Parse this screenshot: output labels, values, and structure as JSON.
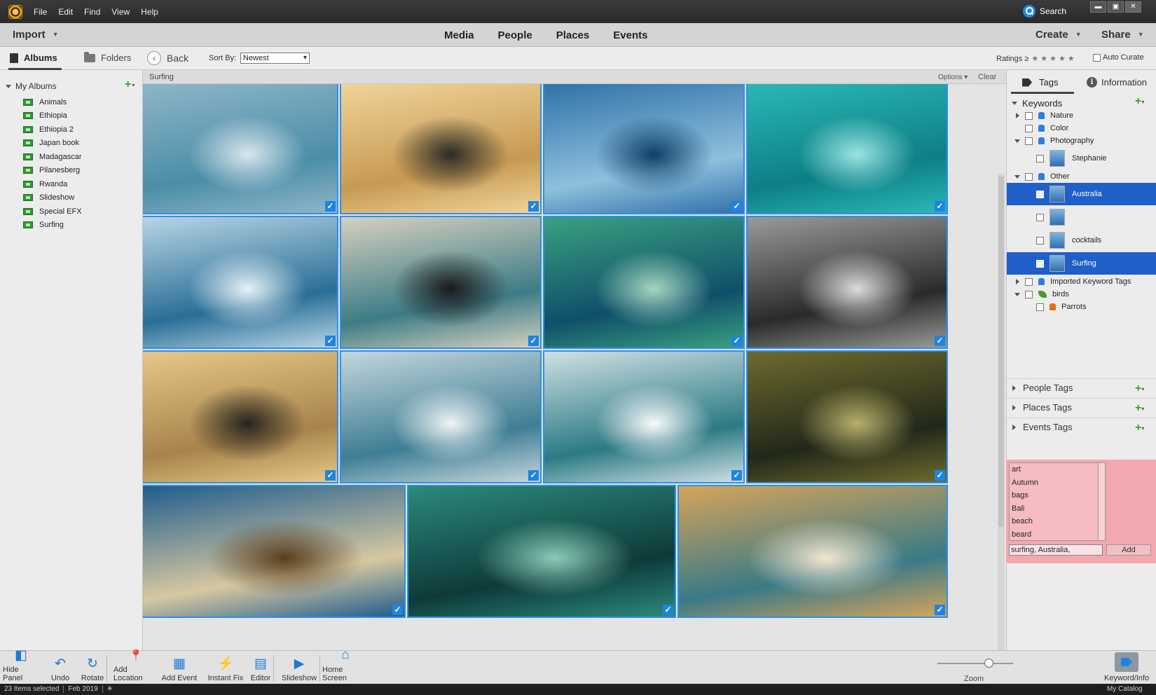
{
  "menu": [
    "File",
    "Edit",
    "Find",
    "View",
    "Help"
  ],
  "titlebar": {
    "search_label": "Search",
    "window_buttons": [
      "▬",
      "▣",
      "✕"
    ]
  },
  "modebar": {
    "import_label": "Import",
    "modes": [
      "Media",
      "People",
      "Places",
      "Events"
    ],
    "create_label": "Create",
    "share_label": "Share"
  },
  "subbar": {
    "albums_tab": "Albums",
    "folders_tab": "Folders",
    "back_label": "Back",
    "sort_by_label": "Sort By:",
    "sort_value": "Newest",
    "ratings_label": "Ratings ≥",
    "ratings_stars": "★★★★★",
    "auto_curate_label": "Auto Curate"
  },
  "left_panel": {
    "section_label": "My Albums",
    "albums": [
      "Animals",
      "Ethiopia",
      "Ethiopia 2",
      "Japan book",
      "Madagascar",
      "Pilanesberg",
      "Rwanda",
      "Slideshow",
      "Special EFX",
      "Surfing"
    ]
  },
  "content": {
    "title": "Surfing",
    "options_label": "Options",
    "clear_label": "Clear",
    "photos": [
      {
        "name": "surfer-girl-wading",
        "colors": [
          "#8fb6c8",
          "#4b8ea8",
          "#d8e6ec"
        ],
        "checked": true
      },
      {
        "name": "surfer-sunset-spray",
        "colors": [
          "#f1d49a",
          "#c79a52",
          "#2a2a26"
        ],
        "checked": true
      },
      {
        "name": "kitesurfer-wave",
        "colors": [
          "#2f72a8",
          "#8fbfdc",
          "#0f3f66"
        ],
        "checked": true
      },
      {
        "name": "surfer-tube-turquoise",
        "colors": [
          "#2bb8b6",
          "#0d7f86",
          "#9ae4e0"
        ],
        "checked": true
      },
      {
        "name": "surfer-small-wave-sky",
        "colors": [
          "#b8d6e6",
          "#2a6e96",
          "#e7f2f7"
        ],
        "checked": true
      },
      {
        "name": "surfer-white-water",
        "colors": [
          "#d6d0c0",
          "#3d7c86",
          "#1b1b1b"
        ],
        "checked": true
      },
      {
        "name": "surfer-green-wave",
        "colors": [
          "#3aa080",
          "#0f4f6a",
          "#a6d6c0"
        ],
        "checked": true
      },
      {
        "name": "surfer-bw-spray",
        "colors": [
          "#9a9a9a",
          "#2a2a2a",
          "#dcdcdc"
        ],
        "checked": true
      },
      {
        "name": "surfer-sunset-carve",
        "colors": [
          "#e8c88a",
          "#a8844a",
          "#262420"
        ],
        "checked": true
      },
      {
        "name": "two-surfers-foam",
        "colors": [
          "#c4d6dc",
          "#3e7e94",
          "#f0f4f4"
        ],
        "checked": true
      },
      {
        "name": "surfer-foam-ride",
        "colors": [
          "#cfe0e4",
          "#2c7a84",
          "#fafafa"
        ],
        "checked": true
      },
      {
        "name": "surfer-barrel-golden",
        "colors": [
          "#6e6a2e",
          "#22281a",
          "#b8b06a"
        ],
        "checked": true
      },
      {
        "name": "wave-barrel-blue",
        "colors": [
          "#1e5c8e",
          "#d6c8a0",
          "#5a3e1e"
        ],
        "checked": true
      },
      {
        "name": "wave-curl-green",
        "colors": [
          "#2b8a7a",
          "#0e3a3a",
          "#8ccab8"
        ],
        "checked": true
      },
      {
        "name": "windsurfer-sunset",
        "colors": [
          "#d6a45a",
          "#3a7a86",
          "#f2e6d0"
        ],
        "checked": true
      }
    ]
  },
  "right_panel": {
    "tags_tab": "Tags",
    "info_tab": "Information",
    "keywords_label": "Keywords",
    "tree": [
      {
        "label": "Nature",
        "indent": 0,
        "twisty": "right",
        "icon": "pin",
        "selected": false
      },
      {
        "label": "Color",
        "indent": 0,
        "twisty": "",
        "icon": "pin",
        "selected": false
      },
      {
        "label": "Photography",
        "indent": 0,
        "twisty": "down",
        "icon": "pin",
        "selected": false
      },
      {
        "label": "Stephanie",
        "indent": 1,
        "twisty": "",
        "icon": "thumb",
        "selected": false
      },
      {
        "label": "Other",
        "indent": 0,
        "twisty": "down",
        "icon": "pin",
        "selected": false
      },
      {
        "label": "Australia",
        "indent": 1,
        "twisty": "",
        "icon": "thumb",
        "selected": true
      },
      {
        "label": "",
        "indent": 1,
        "twisty": "",
        "icon": "thumb",
        "selected": false
      },
      {
        "label": "cocktails",
        "indent": 1,
        "twisty": "",
        "icon": "thumb",
        "selected": false
      },
      {
        "label": "Surfing",
        "indent": 1,
        "twisty": "",
        "icon": "thumb",
        "selected": true
      },
      {
        "label": "Imported Keyword Tags",
        "indent": 0,
        "twisty": "right",
        "icon": "pin",
        "selected": false
      },
      {
        "label": "birds",
        "indent": 0,
        "twisty": "down",
        "icon": "leaf",
        "selected": false
      },
      {
        "label": "Parrots",
        "indent": 1,
        "twisty": "",
        "icon": "pin-orange",
        "selected": false
      }
    ],
    "sections": [
      "People Tags",
      "Places Tags",
      "Events Tags"
    ],
    "keyword_suggestions": [
      "art",
      "Autumn",
      "bags",
      "Bali",
      "beach",
      "beard"
    ],
    "keyword_input_value": "surfing, Australia,",
    "add_button_label": "Add"
  },
  "bottom_toolbar": {
    "tools": [
      {
        "label": "Hide Panel",
        "icon": "hide-panel-icon",
        "glyph": "◧"
      },
      {
        "label": "Undo",
        "icon": "undo-icon",
        "glyph": "↶"
      },
      {
        "label": "Rotate",
        "icon": "rotate-icon",
        "glyph": "↻"
      },
      {
        "label": "Add Location",
        "icon": "location-pin-icon",
        "glyph": "📍"
      },
      {
        "label": "Add Event",
        "icon": "calendar-icon",
        "glyph": "▦"
      },
      {
        "label": "Instant Fix",
        "icon": "lightning-icon",
        "glyph": "⚡"
      },
      {
        "label": "Editor",
        "icon": "editor-icon",
        "glyph": "▤"
      },
      {
        "label": "Slideshow",
        "icon": "slideshow-icon",
        "glyph": "▶"
      },
      {
        "label": "Home Screen",
        "icon": "home-icon",
        "glyph": "⌂"
      }
    ],
    "zoom_label": "Zoom",
    "zoom_level": 0.68,
    "keyword_info_label": "Keyword/Info"
  },
  "statusbar": {
    "items_selected": "23 Items selected",
    "date": "Feb 2019",
    "catalog": "My Catalog"
  },
  "accent_color": "#1e84e0"
}
